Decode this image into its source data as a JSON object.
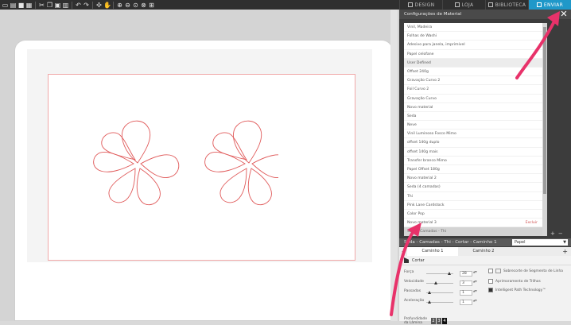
{
  "toolbar": {
    "buttons": [
      "new-icon",
      "open-icon",
      "save-icon",
      "print-icon",
      "cut-icon",
      "copy-icon",
      "paste-icon",
      "delete-icon",
      "undo-icon",
      "redo-icon",
      "select-icon",
      "pan-icon",
      "zoom-in-icon",
      "zoom-out-icon",
      "zoom-selection-icon",
      "zoom-fit-icon",
      "fill-page-icon"
    ]
  },
  "tabs": [
    {
      "label": "DESIGN",
      "active": false
    },
    {
      "label": "LOJA",
      "active": false
    },
    {
      "label": "BIBLIOTECA",
      "active": false
    },
    {
      "label": "ENVIAR",
      "active": true
    }
  ],
  "panel": {
    "title": "Configurações de Material",
    "materials": [
      {
        "label": "Vinil, Madeira",
        "state": "normal"
      },
      {
        "label": "Folhas de Washi",
        "state": "normal"
      },
      {
        "label": "Adesivo para janela, imprimível",
        "state": "normal"
      },
      {
        "label": "Papel celofane",
        "state": "normal"
      },
      {
        "label": "User Defined",
        "state": "shaded"
      },
      {
        "label": "Offset 240g",
        "state": "normal"
      },
      {
        "label": "Gravação Curvo 2",
        "state": "normal"
      },
      {
        "label": "Foil Curvo 2",
        "state": "normal"
      },
      {
        "label": "Gravação Curvo",
        "state": "normal"
      },
      {
        "label": "Novo material",
        "state": "normal"
      },
      {
        "label": "Seda",
        "state": "normal"
      },
      {
        "label": "Neve",
        "state": "normal"
      },
      {
        "label": "Vinil Luminoso Fosco Mimo",
        "state": "normal"
      },
      {
        "label": "offset 140g duplo",
        "state": "normal"
      },
      {
        "label": "offset 140g mais",
        "state": "normal"
      },
      {
        "label": "Transfer branco Mimo",
        "state": "normal"
      },
      {
        "label": "Papel Offset 180g",
        "state": "normal"
      },
      {
        "label": "Novo material 2",
        "state": "normal"
      },
      {
        "label": "Seda (4 camadas)",
        "state": "normal"
      },
      {
        "label": "Thi",
        "state": "normal"
      },
      {
        "label": "Pink Lane Cardstock",
        "state": "normal"
      },
      {
        "label": "Color Pop",
        "state": "normal"
      },
      {
        "label": "Novo material 3",
        "state": "normal",
        "delete_label": "Excluir"
      },
      {
        "label": "Seda - Camadas - Thi",
        "state": "selected"
      }
    ],
    "list_add": "+",
    "list_remove": "−"
  },
  "cut": {
    "header": "Seda - Camadas - Thi - Cortar - Caminho 1",
    "paper_select": "Papel",
    "path_tabs": [
      {
        "label": "Caminho 1",
        "active": true
      },
      {
        "label": "Caminho 2",
        "active": false
      }
    ],
    "section_title": "Cortar",
    "fields": [
      {
        "label": "Força",
        "value": "28",
        "level": 0.85
      },
      {
        "label": "Velocidade",
        "value": "3",
        "level": 0.3
      },
      {
        "label": "Passadas",
        "value": "1",
        "level": 0.05
      },
      {
        "label": "Aceleração",
        "value": "1",
        "level": 0.05
      }
    ],
    "options": [
      {
        "label": "Sobrecorte de Segmento de Linha",
        "checked": false
      },
      {
        "label": "Aprimoramento de Trilhos",
        "checked": false
      },
      {
        "label": "Intelligent Path Technology™",
        "checked": true
      }
    ],
    "depth_label": "Profundidade da Lâmina",
    "blade_values": [
      "2",
      "3",
      "4"
    ],
    "blade_current": "4"
  },
  "colors": {
    "accent": "#1f98c9",
    "cut_line": "#e05a5a",
    "annotation_arrow": "#e8326a"
  }
}
